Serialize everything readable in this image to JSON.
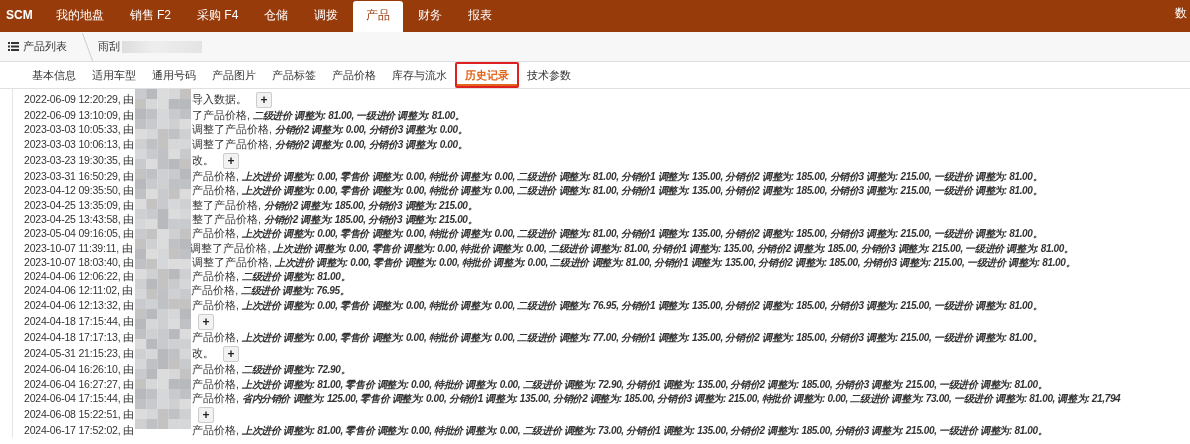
{
  "header": {
    "brand": "SCM",
    "nav": [
      {
        "label": "我的地盘",
        "selected": false
      },
      {
        "label": "销售 F2",
        "selected": false
      },
      {
        "label": "采购 F4",
        "selected": false
      },
      {
        "label": "仓储",
        "selected": false
      },
      {
        "label": "调拨",
        "selected": false
      },
      {
        "label": "产品",
        "selected": true
      },
      {
        "label": "财务",
        "selected": false
      },
      {
        "label": "报表",
        "selected": false
      }
    ],
    "right_text": "数"
  },
  "breadcrumb": {
    "list_label": "产品列表",
    "current": "雨刮"
  },
  "tabs": [
    {
      "label": "基本信息",
      "selected": false
    },
    {
      "label": "适用车型",
      "selected": false
    },
    {
      "label": "通用号码",
      "selected": false
    },
    {
      "label": "产品图片",
      "selected": false
    },
    {
      "label": "产品标签",
      "selected": false
    },
    {
      "label": "产品价格",
      "selected": false
    },
    {
      "label": "库存与流水",
      "selected": false
    },
    {
      "label": "历史记录",
      "selected": true
    },
    {
      "label": "技术参数",
      "selected": false
    }
  ],
  "history": [
    {
      "time": "2022-06-09 12:20:29, 由",
      "action": "导入数据。",
      "button": "+"
    },
    {
      "time": "2022-06-09 13:10:09, 由",
      "action": "了产品价格,",
      "detail": "二级进价 调整为: 81.00, 一级进价 调整为: 81.00。"
    },
    {
      "time": "2023-03-03 10:05:33, 由",
      "action": "调整了产品价格,",
      "detail": "分销价2 调整为: 0.00, 分销价3 调整为: 0.00。"
    },
    {
      "time": "2023-03-03 10:06:13, 由",
      "action": "调整了产品价格,",
      "detail": "分销价2 调整为: 0.00, 分销价3 调整为: 0.00。"
    },
    {
      "time": "2023-03-23 19:30:35, 由",
      "action": "改。",
      "button": "+"
    },
    {
      "time": "2023-03-31 16:50:29, 由",
      "action": "产品价格,",
      "detail": "上次进价 调整为: 0.00, 零售价 调整为: 0.00, 特批价 调整为: 0.00, 二级进价 调整为: 81.00, 分销价1 调整为: 135.00, 分销价2 调整为: 185.00, 分销价3 调整为: 215.00, 一级进价 调整为: 81.00。"
    },
    {
      "time": "2023-04-12 09:35:50, 由",
      "action": "产品价格,",
      "detail": "上次进价 调整为: 0.00, 零售价 调整为: 0.00, 特批价 调整为: 0.00, 二级进价 调整为: 81.00, 分销价1 调整为: 135.00, 分销价2 调整为: 185.00, 分销价3 调整为: 215.00, 一级进价 调整为: 81.00。"
    },
    {
      "time": "2023-04-25 13:35:09, 由",
      "action": "整了产品价格,",
      "detail": "分销价2 调整为: 185.00, 分销价3 调整为: 215.00。"
    },
    {
      "time": "2023-04-25 13:43:58, 由",
      "action": "整了产品价格,",
      "detail": "分销价2 调整为: 185.00, 分销价3 调整为: 215.00。"
    },
    {
      "time": "2023-05-04 09:16:05, 由",
      "action": "产品价格,",
      "detail": "上次进价 调整为: 0.00, 零售价 调整为: 0.00, 特批价 调整为: 0.00, 二级进价 调整为: 81.00, 分销价1 调整为: 135.00, 分销价2 调整为: 185.00, 分销价3 调整为: 215.00, 一级进价 调整为: 81.00。"
    },
    {
      "time": "2023-10-07 11:39:11, 由",
      "action": "调整了产品价格,",
      "detail": "上次进价 调整为: 0.00, 零售价 调整为: 0.00, 特批价 调整为: 0.00, 二级进价 调整为: 81.00, 分销价1 调整为: 135.00, 分销价2 调整为: 185.00, 分销价3 调整为: 215.00, 一级进价 调整为: 81.00。"
    },
    {
      "time": "2023-10-07 18:03:40, 由",
      "action": "调整了产品价格,",
      "detail": "上次进价 调整为: 0.00, 零售价 调整为: 0.00, 特批价 调整为: 0.00, 二级进价 调整为: 81.00, 分销价1 调整为: 135.00, 分销价2 调整为: 185.00, 分销价3 调整为: 215.00, 一级进价 调整为: 81.00。"
    },
    {
      "time": "2024-04-06 12:06:22, 由",
      "action": "产品价格,",
      "detail": "二级进价 调整为: 81.00。"
    },
    {
      "time": "2024-04-06 12:11:02, 由",
      "action": "产品价格,",
      "detail": "二级进价 调整为: 76.95。"
    },
    {
      "time": "2024-04-06 12:13:32, 由",
      "action": "产品价格,",
      "detail": "上次进价 调整为: 0.00, 零售价 调整为: 0.00, 特批价 调整为: 0.00, 二级进价 调整为: 76.95, 分销价1 调整为: 135.00, 分销价2 调整为: 185.00, 分销价3 调整为: 215.00, 一级进价 调整为: 81.00。"
    },
    {
      "time": "2024-04-18 17:15:44, 由",
      "button": "+"
    },
    {
      "time": "2024-04-18 17:17:13, 由",
      "action": "产品价格,",
      "detail": "上次进价 调整为: 0.00, 零售价 调整为: 0.00, 特批价 调整为: 0.00, 二级进价 调整为: 77.00, 分销价1 调整为: 135.00, 分销价2 调整为: 185.00, 分销价3 调整为: 215.00, 一级进价 调整为: 81.00。"
    },
    {
      "time": "2024-05-31 21:15:23, 由",
      "action": "改。",
      "button": "+"
    },
    {
      "time": "2024-06-04 16:26:10, 由",
      "action": "产品价格,",
      "detail": "二级进价 调整为: 72.90。"
    },
    {
      "time": "2024-06-04 16:27:27, 由",
      "action": "产品价格,",
      "detail": "上次进价 调整为: 81.00, 零售价 调整为: 0.00, 特批价 调整为: 0.00, 二级进价 调整为: 72.90, 分销价1 调整为: 135.00, 分销价2 调整为: 185.00, 分销价3 调整为: 215.00, 一级进价 调整为: 81.00。"
    },
    {
      "time": "2024-06-04 17:15:44, 由",
      "action": "产品价格,",
      "detail": "省内分销价 调整为: 125.00, 零售价 调整为: 0.00, 分销价1 调整为: 135.00, 分销价2 调整为: 185.00, 分销价3 调整为: 215.00, 特批价 调整为: 0.00, 二级进价 调整为: 73.00, 一级进价 调整为: 81.00, 调整为: 21,794"
    },
    {
      "time": "2024-06-08 15:22:51, 由",
      "button": "+"
    },
    {
      "time": "2024-06-17 17:52:02, 由",
      "action": "产品价格,",
      "detail": "上次进价 调整为: 81.00, 零售价 调整为: 0.00, 特批价 调整为: 0.00, 二级进价 调整为: 73.00, 分销价1 调整为: 135.00, 分销价2 调整为: 185.00, 分销价3 调整为: 215.00, 一级进价 调整为: 81.00。"
    }
  ]
}
